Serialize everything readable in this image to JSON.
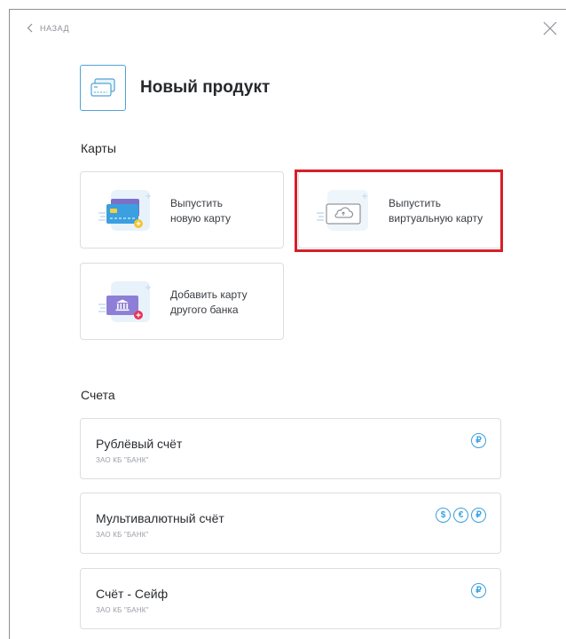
{
  "nav": {
    "back_label": "НАЗАД"
  },
  "header": {
    "title": "Новый продукт"
  },
  "cards_section": {
    "title": "Карты",
    "tiles": [
      {
        "label": "Выпустить\nновую карту"
      },
      {
        "label": "Выпустить\nвиртуальную карту"
      },
      {
        "label": "Добавить карту\nдругого банка"
      }
    ]
  },
  "accounts_section": {
    "title": "Счета",
    "accounts": [
      {
        "name": "Рублёвый счёт",
        "bank": "ЗАО КБ \"БАНК\"",
        "currencies": [
          "₽"
        ]
      },
      {
        "name": "Мультивалютный счёт",
        "bank": "ЗАО КБ \"БАНК\"",
        "currencies": [
          "$",
          "€",
          "₽"
        ]
      },
      {
        "name": "Счёт - Сейф",
        "bank": "ЗАО КБ \"БАНК\"",
        "currencies": [
          "₽"
        ]
      }
    ]
  },
  "colors": {
    "accent": "#3aa0df",
    "highlight": "#d81e28",
    "border": "#dcdde0"
  }
}
